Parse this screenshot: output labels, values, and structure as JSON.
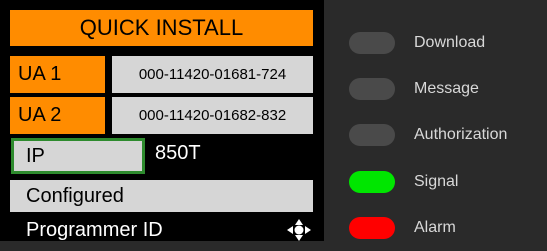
{
  "panel": {
    "title": "QUICK INSTALL",
    "ua_rows": [
      {
        "label": "UA 1",
        "value": "000-11420-01681-724"
      },
      {
        "label": "UA 2",
        "value": "000-11420-01682-832"
      }
    ],
    "ip": {
      "label": "IP",
      "value": "850T"
    },
    "status": "Configured",
    "programmer_label": "Programmer ID",
    "nav_icon": "navigation-arrows-icon"
  },
  "indicators": [
    {
      "label": "Download",
      "state": "off",
      "color": "#4a4a4a"
    },
    {
      "label": "Message",
      "state": "off",
      "color": "#4a4a4a"
    },
    {
      "label": "Authorization",
      "state": "off",
      "color": "#4a4a4a"
    },
    {
      "label": "Signal",
      "state": "on",
      "color": "#00e600"
    },
    {
      "label": "Alarm",
      "state": "on",
      "color": "#ff0000"
    }
  ],
  "colors": {
    "accent": "#ff8c00",
    "field": "#d6d6d6",
    "ip_border": "#2e8b2e",
    "background": "#2a2a2a",
    "panel": "#000000"
  }
}
